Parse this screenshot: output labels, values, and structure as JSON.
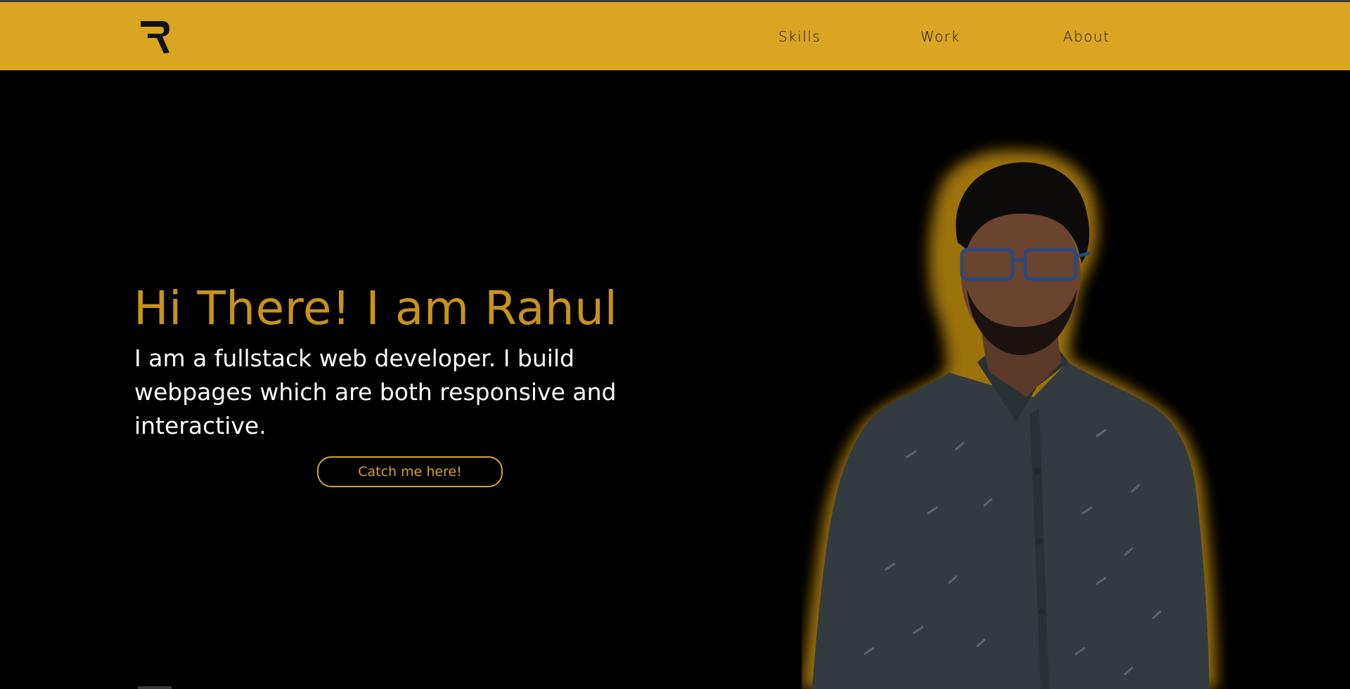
{
  "header": {
    "logo_icon": "r-monogram-icon",
    "nav": [
      {
        "label": "Skills"
      },
      {
        "label": "Work"
      },
      {
        "label": "About"
      }
    ]
  },
  "hero": {
    "title": "Hi There! I am Rahul",
    "subtitle": "I am a fullstack web developer. I build webpages which are both responsive and interactive.",
    "cta_label": "Catch me here!",
    "portrait_icon": "person-portrait-icon"
  },
  "colors": {
    "accent": "#DAA520",
    "title": "#C8921B",
    "background": "#000000",
    "text": "#FFFFFF",
    "shirt": "#333B40"
  }
}
